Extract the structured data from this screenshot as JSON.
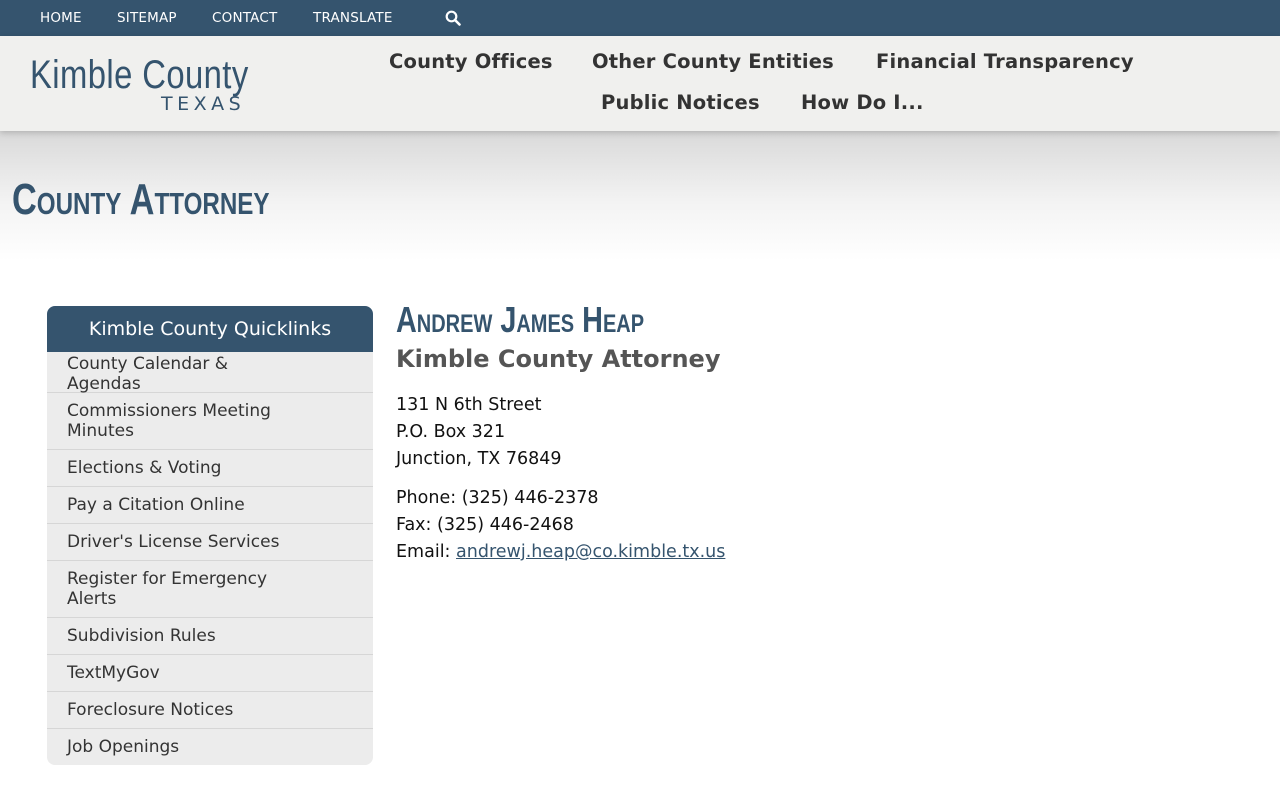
{
  "utility_nav": {
    "home": "HOME",
    "sitemap": "SITEMAP",
    "contact": "CONTACT",
    "translate": "TRANSLATE",
    "search_icon": "search-icon"
  },
  "logo": {
    "name": "Kimble County",
    "state": "TEXAS"
  },
  "main_nav": [
    "County Offices",
    "Other County Entities",
    "Financial Transparency",
    "Public Notices",
    "How Do I..."
  ],
  "page": {
    "title": "County Attorney"
  },
  "sidebar": {
    "heading": "Kimble County Quicklinks",
    "items": [
      "County Calendar & Agendas",
      "Commissioners Meeting Minutes",
      "Elections & Voting",
      "Pay a Citation Online",
      "Driver's License Services",
      "Register for Emergency Alerts",
      "Subdivision Rules",
      "TextMyGov",
      "Foreclosure Notices",
      "Job Openings"
    ]
  },
  "content": {
    "name": "Andrew James Heap",
    "title": "Kimble County Attorney",
    "address": [
      "131 N 6th Street",
      "P.O. Box 321",
      "Junction, TX 76849"
    ],
    "phone_label": "Phone:",
    "phone": "(325) 446-2378",
    "fax_label": "Fax:",
    "fax": "(325) 446-2468",
    "email_label": "Email:",
    "email": "andrewj.heap@co.kimble.tx.us"
  },
  "colors": {
    "brand": "#35546e",
    "header_bg": "#f0f0ee",
    "sidebar_bg": "#ececec"
  }
}
